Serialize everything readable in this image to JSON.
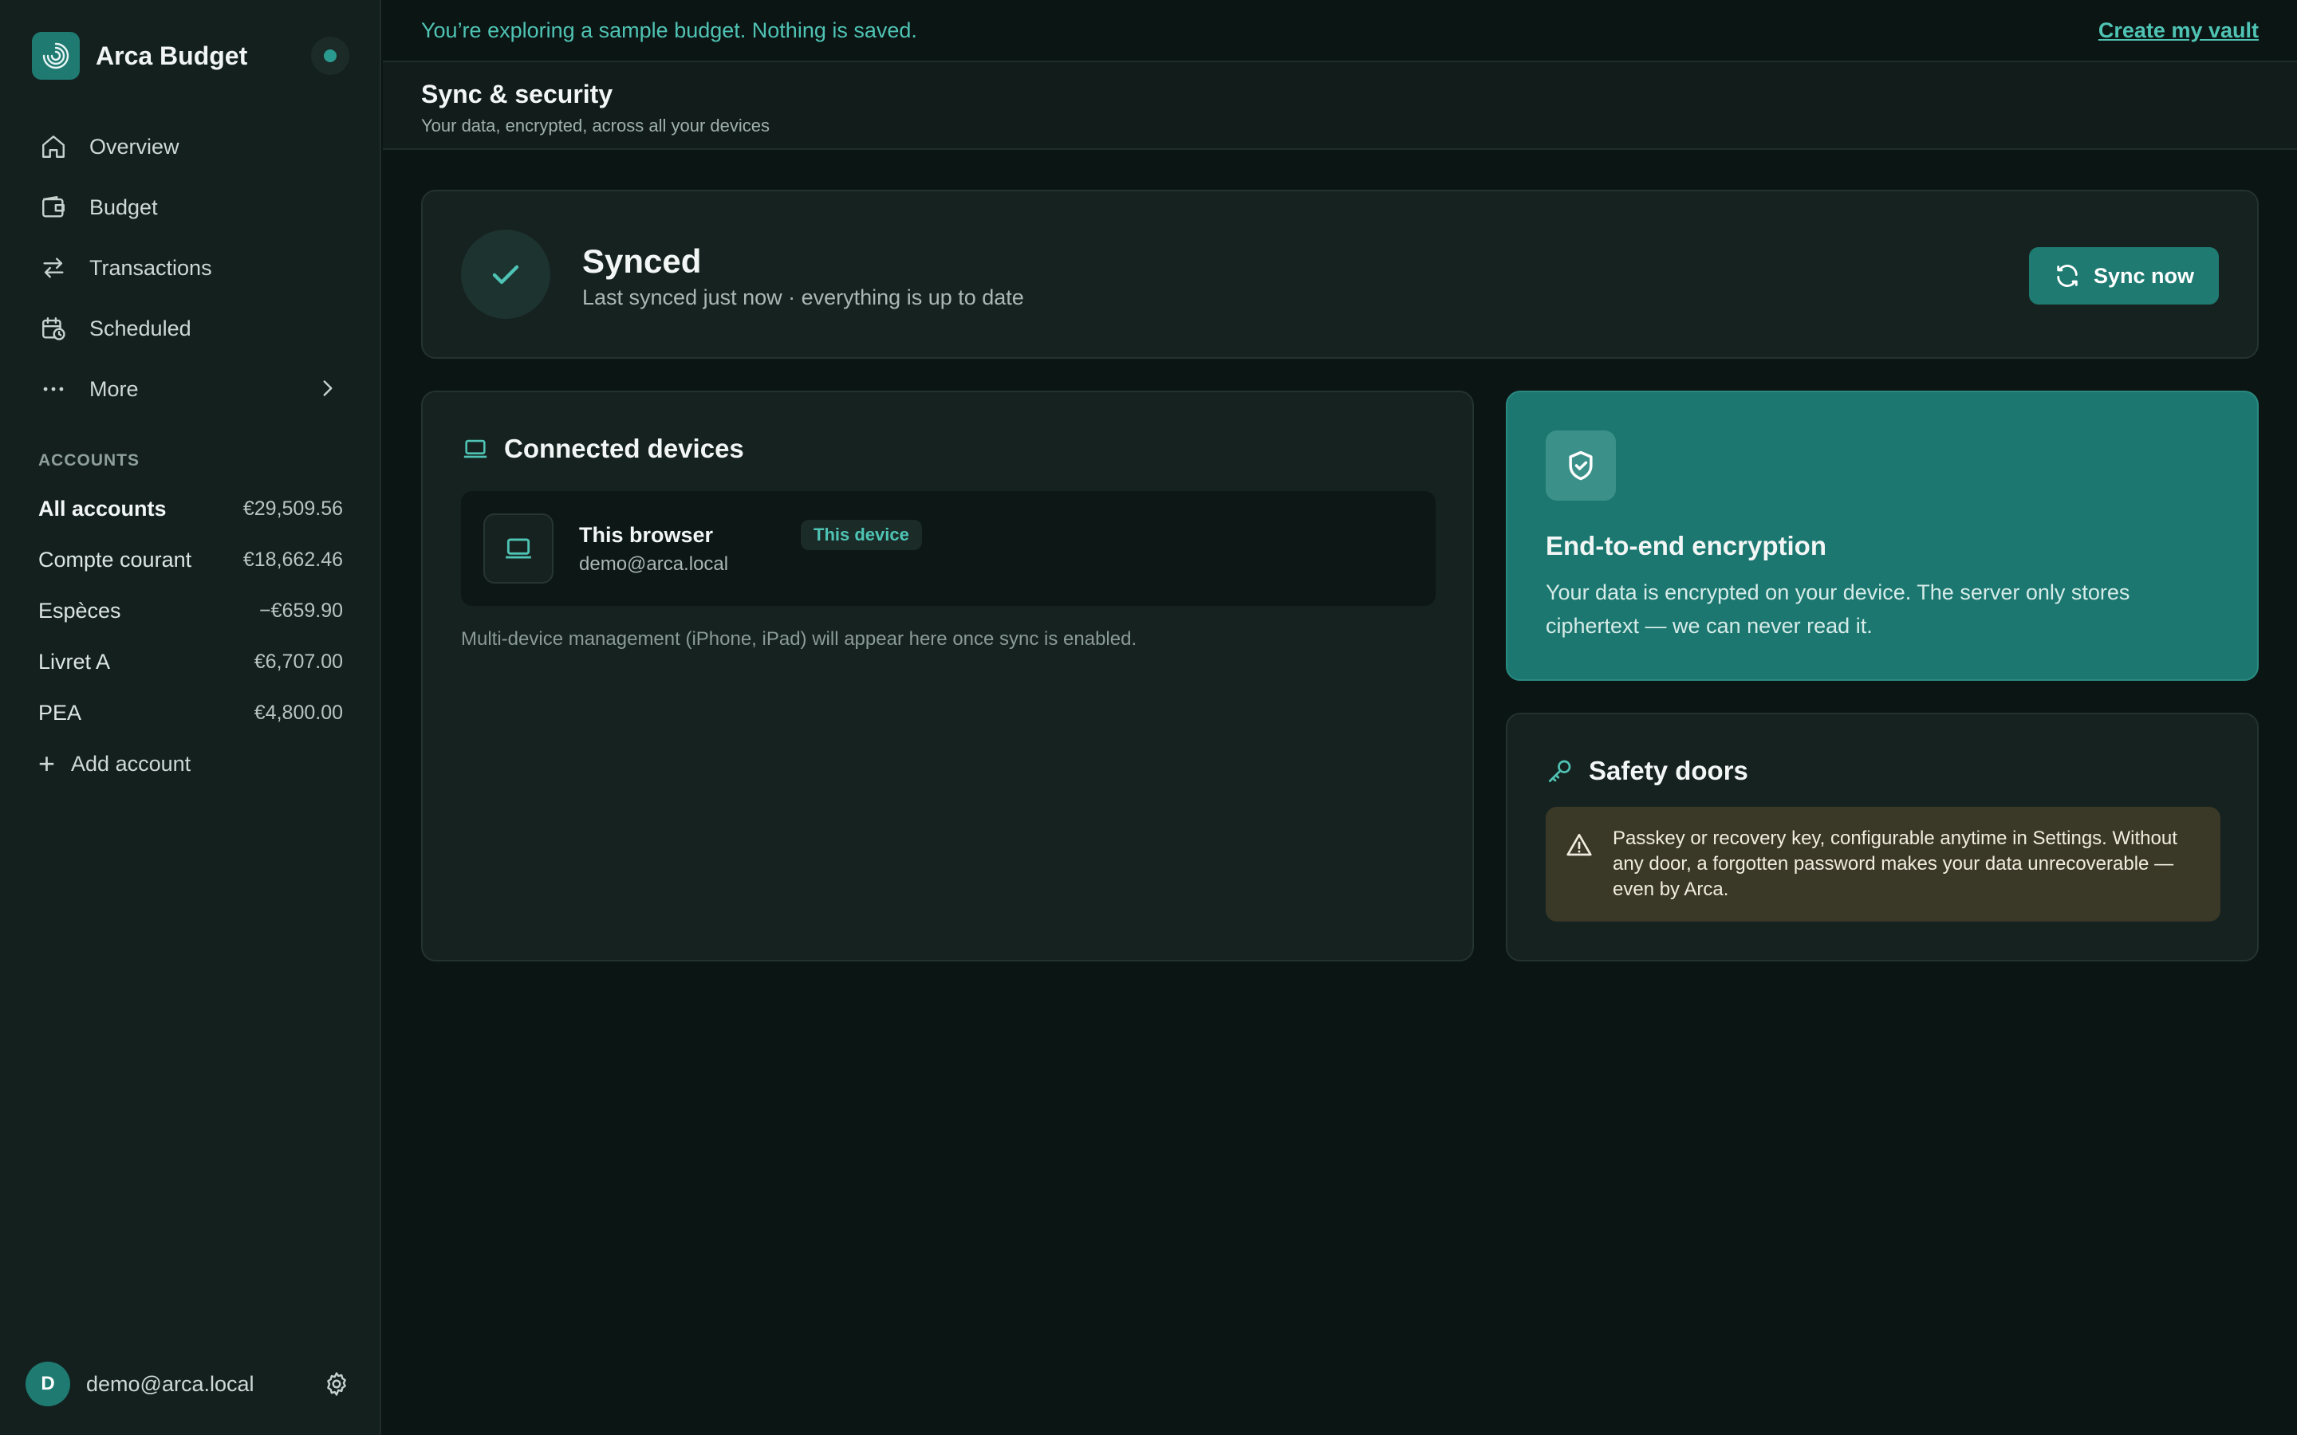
{
  "app": {
    "name": "Arca Budget"
  },
  "nav": [
    {
      "label": "Overview",
      "icon": "home-icon"
    },
    {
      "label": "Budget",
      "icon": "wallet-icon"
    },
    {
      "label": "Transactions",
      "icon": "transfer-arrows-icon"
    },
    {
      "label": "Scheduled",
      "icon": "calendar-clock-icon"
    },
    {
      "label": "More",
      "icon": "ellipsis-icon"
    }
  ],
  "accounts": {
    "heading": "ACCOUNTS",
    "items": [
      {
        "name": "All accounts",
        "value": "€29,509.56"
      },
      {
        "name": "Compte courant",
        "value": "€18,662.46"
      },
      {
        "name": "Espèces",
        "value": "−€659.90"
      },
      {
        "name": "Livret A",
        "value": "€6,707.00"
      },
      {
        "name": "PEA",
        "value": "€4,800.00"
      }
    ],
    "add_label": "Add account"
  },
  "user": {
    "initial": "D",
    "email": "demo@arca.local"
  },
  "banner": {
    "text": "You’re exploring a sample budget. Nothing is saved.",
    "link": "Create my vault"
  },
  "page": {
    "title": "Sync & security",
    "subtitle": "Your data, encrypted, across all your devices"
  },
  "sync": {
    "status": "Synced",
    "detail": "Last synced just now · everything is up to date",
    "button": "Sync now"
  },
  "devices": {
    "title": "Connected devices",
    "items": [
      {
        "name": "This browser",
        "badge": "This device",
        "email": "demo@arca.local"
      }
    ],
    "note": "Multi-device management (iPhone, iPad) will appear here once sync is enabled."
  },
  "encryption": {
    "title": "End-to-end encryption",
    "body": "Your data is encrypted on your device. The server only stores ciphertext — we can never read it."
  },
  "safety": {
    "title": "Safety doors",
    "warning": "Passkey or recovery key, configurable anytime in Settings. Without any door, a forgotten password makes your data unrecoverable — even by Arca."
  },
  "colors": {
    "accent": "#1f7a72",
    "accent_text": "#4fc3b4",
    "background": "#0b1513",
    "sidebar": "#13201e",
    "card": "#16221f",
    "warning_bg": "#3a3826"
  }
}
